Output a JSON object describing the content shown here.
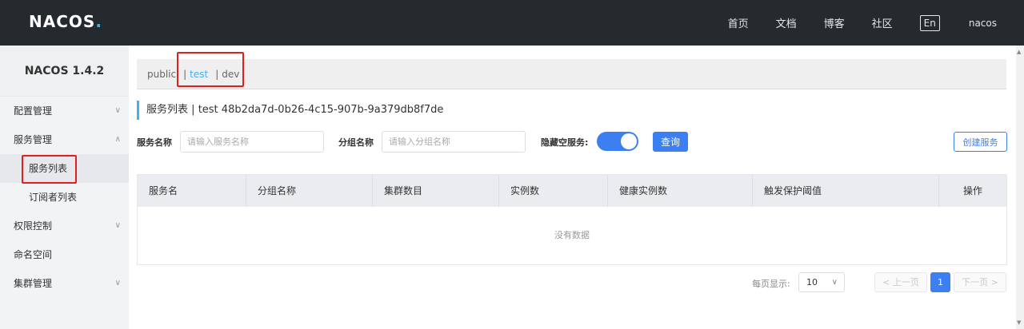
{
  "header": {
    "logo_main": "NACOS",
    "logo_dot": ".",
    "nav": [
      "首页",
      "文档",
      "博客",
      "社区"
    ],
    "lang": "En",
    "user": "nacos"
  },
  "sidebar": {
    "title": "NACOS 1.4.2",
    "items": [
      {
        "label": "配置管理",
        "chevron": "chevron-down-icon"
      },
      {
        "label": "服务管理",
        "chevron": "chevron-up-icon"
      },
      {
        "label": "服务列表"
      },
      {
        "label": "订阅者列表"
      },
      {
        "label": "权限控制",
        "chevron": "chevron-down-icon"
      },
      {
        "label": "命名空间"
      },
      {
        "label": "集群管理",
        "chevron": "chevron-down-icon"
      }
    ]
  },
  "namespaces": {
    "items": [
      "public",
      "test",
      "dev"
    ],
    "separator": "|",
    "active": "test"
  },
  "page": {
    "title": "服务列表",
    "separator": "|",
    "namespace_name": "test",
    "namespace_id": "48b2da7d-0b26-4c15-907b-9a379db8f7de"
  },
  "filters": {
    "service_name_label": "服务名称",
    "service_name_placeholder": "请输入服务名称",
    "group_name_label": "分组名称",
    "group_name_placeholder": "请输入分组名称",
    "hide_empty_label": "隐藏空服务:",
    "hide_empty_on": true,
    "query_label": "查询",
    "create_label": "创建服务"
  },
  "table": {
    "columns": [
      "服务名",
      "分组名称",
      "集群数目",
      "实例数",
      "健康实例数",
      "触发保护阈值",
      "操作"
    ],
    "empty_text": "没有数据"
  },
  "pagination": {
    "per_page_label": "每页显示:",
    "per_page_value": "10",
    "prev_label": "< 上一页",
    "current_page": "1",
    "next_label": "下一页 >"
  },
  "colors": {
    "topbar": "#252a2f",
    "accent": "#3b7ff0",
    "link": "#3cb1f7",
    "highlight_box": "#e02020"
  }
}
